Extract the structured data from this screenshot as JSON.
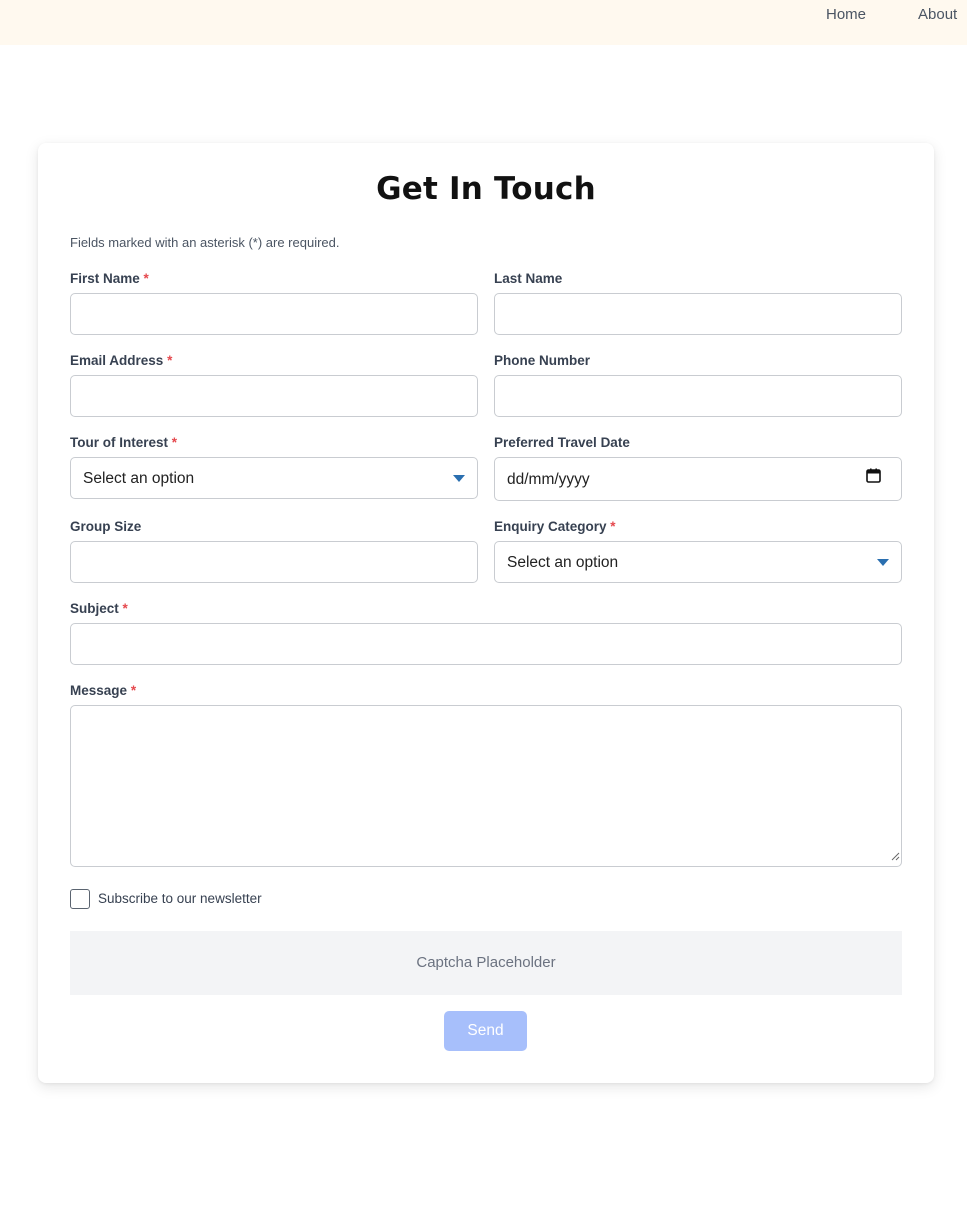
{
  "nav": {
    "items": [
      {
        "label": "Home"
      },
      {
        "label": "About"
      }
    ]
  },
  "form": {
    "title": "Get In Touch",
    "required_note": "Fields marked with an asterisk (*) are required.",
    "required_marker": "*",
    "fields": {
      "first_name": {
        "label": "First Name",
        "value": ""
      },
      "last_name": {
        "label": "Last Name",
        "value": ""
      },
      "email": {
        "label": "Email Address",
        "value": ""
      },
      "phone": {
        "label": "Phone Number",
        "value": ""
      },
      "tour": {
        "label": "Tour of Interest",
        "selected": "Select an option"
      },
      "travel_date": {
        "label": "Preferred Travel Date",
        "placeholder": "dd/mm/yyyy"
      },
      "group_size": {
        "label": "Group Size",
        "value": ""
      },
      "category": {
        "label": "Enquiry Category",
        "selected": "Select an option"
      },
      "subject": {
        "label": "Subject",
        "value": ""
      },
      "message": {
        "label": "Message",
        "value": ""
      }
    },
    "newsletter_label": "Subscribe to our newsletter",
    "newsletter_checked": false,
    "captcha_text": "Captcha Placeholder",
    "send_label": "Send"
  },
  "colors": {
    "topbar_bg": "#fff9ef",
    "required": "#e5484d",
    "send_button": "#a7bffb",
    "select_caret": "#2a6fb0"
  },
  "icons": {
    "tour_select": "chevron-down-icon",
    "category_select": "chevron-down-icon",
    "travel_date": "calendar-icon"
  }
}
